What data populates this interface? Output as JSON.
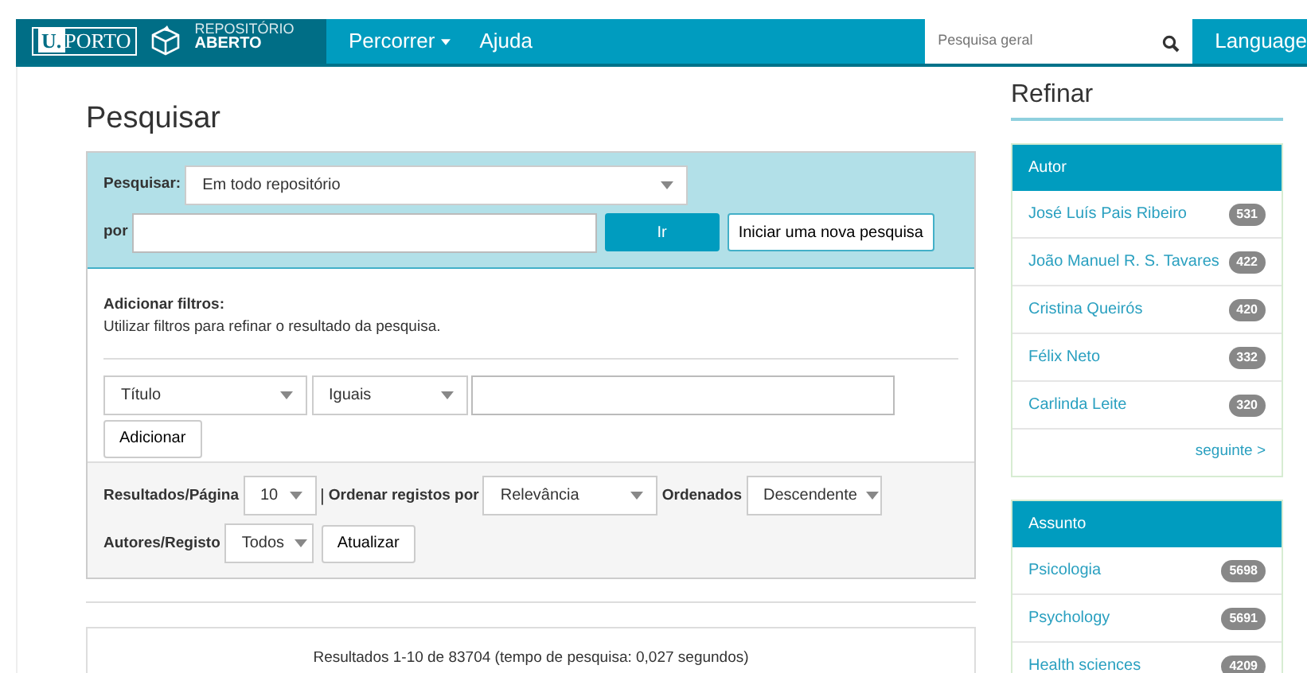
{
  "header": {
    "logo_university": "U.PORTO",
    "logo_repo_top": "REPOSITÓRIO",
    "logo_repo_bottom": "ABERTO",
    "menu": [
      {
        "label": "Percorrer",
        "dropdown": true
      },
      {
        "label": "Ajuda",
        "dropdown": false
      }
    ],
    "search": {
      "placeholder": "Pesquisa geral"
    },
    "language": "Language"
  },
  "page_title": "Pesquisar",
  "search_form": {
    "scope_label": "Pesquisar:",
    "scope_value": "Em todo repositório",
    "query_label": "por",
    "go_button": "Ir",
    "new_search_button": "Iniciar uma nova pesquisa"
  },
  "filters": {
    "title": "Adicionar filtros:",
    "description": "Utilizar filtros para refinar o resultado da pesquisa.",
    "field": "Título",
    "operator": "Iguais",
    "add_button": "Adicionar"
  },
  "display_options": {
    "rpp_label": "Resultados/Página",
    "rpp": "10",
    "separator": "|",
    "sort_label": "Ordenar registos por",
    "sort": "Relevância",
    "order_label": "Ordenados",
    "order": "Descendente",
    "authors_label": "Autores/Registo",
    "authors": "Todos",
    "update_button": "Atualizar"
  },
  "results_summary": "Resultados 1-10 de 83704 (tempo de pesquisa: 0,027 segundos)",
  "sidebar": {
    "title": "Refinar",
    "facets": [
      {
        "title": "Autor",
        "items": [
          {
            "label": "José Luís Pais Ribeiro",
            "count": "531"
          },
          {
            "label": "João Manuel R. S. Tavares",
            "count": "422"
          },
          {
            "label": "Cristina Queirós",
            "count": "420"
          },
          {
            "label": "Félix Neto",
            "count": "332"
          },
          {
            "label": "Carlinda Leite",
            "count": "320"
          }
        ],
        "more_link": "seguinte >"
      },
      {
        "title": "Assunto",
        "items": [
          {
            "label": "Psicologia",
            "count": "5698"
          },
          {
            "label": "Psychology",
            "count": "5691"
          },
          {
            "label": "Health sciences",
            "count": "4209"
          }
        ]
      }
    ]
  }
}
